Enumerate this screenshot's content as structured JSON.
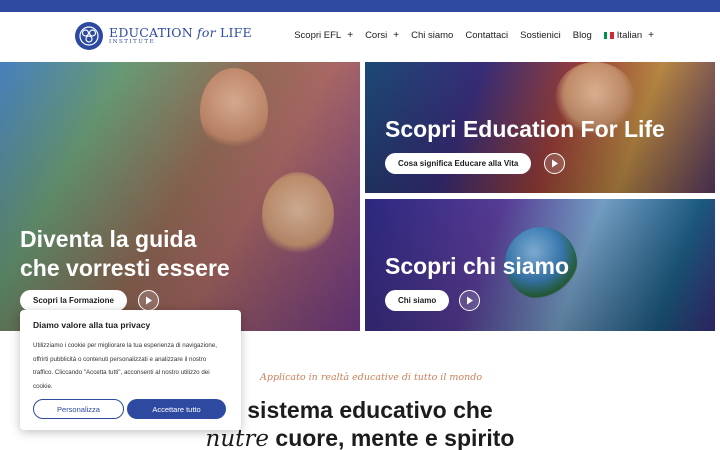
{
  "brand": {
    "name_prefix": "EDUCATION",
    "name_italic": "for",
    "name_suffix": "LIFE",
    "subtitle": "INSTITUTE",
    "color": "#2d4aa0"
  },
  "nav": {
    "items": [
      {
        "label": "Scopri EFL",
        "has_submenu": true
      },
      {
        "label": "Corsi",
        "has_submenu": true
      },
      {
        "label": "Chi siamo",
        "has_submenu": false
      },
      {
        "label": "Contattaci",
        "has_submenu": false
      },
      {
        "label": "Sostienici",
        "has_submenu": false
      },
      {
        "label": "Blog",
        "has_submenu": false
      }
    ],
    "language": {
      "label": "Italian",
      "flag_icon": "italian-flag-icon"
    },
    "plus_symbol": "+"
  },
  "hero": {
    "left": {
      "title_line1": "Diventa la guida",
      "title_line2": "che vorresti essere",
      "button": "Scopri la Formazione",
      "icon": "play-icon"
    },
    "top_right": {
      "title": "Scopri Education For Life",
      "button": "Cosa significa Educare alla Vita",
      "icon": "play-icon"
    },
    "bottom_right": {
      "title": "Scopri chi siamo",
      "button": "Chi siamo",
      "icon": "play-icon"
    }
  },
  "section": {
    "tagline": "Applicato in realtà educative di tutto il mondo",
    "headline_line1": "sistema educativo che",
    "headline_line2_italic": "nutre",
    "headline_line2_rest": "cuore, mente e spirito"
  },
  "cookie_banner": {
    "title": "Diamo valore alla tua privacy",
    "body": "Utilizziamo i cookie per migliorare la tua esperienza di navigazione, offrirti pubblicità o contenuti personalizzati e analizzare il nostro traffico. Cliccando \"Accetta tutti\", acconsenti al nostro utilizzo dei cookie.",
    "customize_button": "Personalizza",
    "accept_button": "Accettare tutto"
  }
}
